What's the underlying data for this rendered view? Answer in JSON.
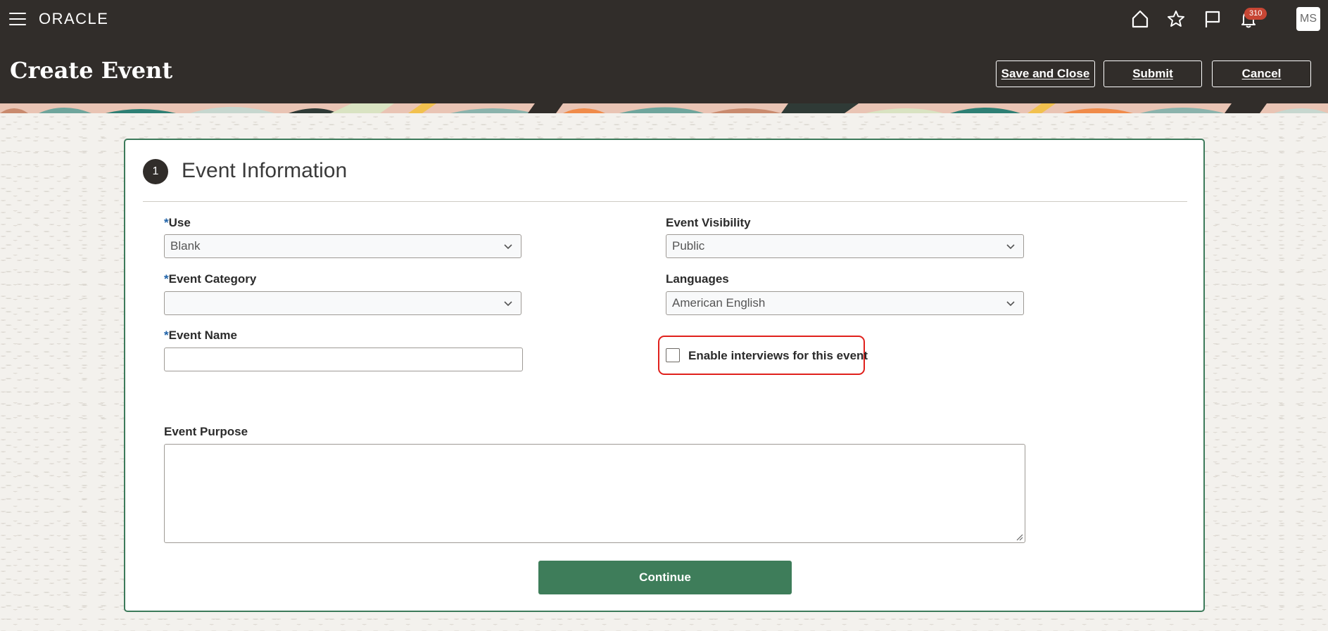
{
  "header": {
    "logo": "ORACLE",
    "notification_count": "310",
    "avatar_initials": "MS",
    "page_title": "Create Event",
    "buttons": {
      "save_and_close": "Save and Close",
      "submit": "Submit",
      "cancel": "Cancel"
    }
  },
  "section": {
    "step_number": "1",
    "title": "Event Information"
  },
  "form": {
    "use": {
      "required": "*",
      "label": "Use",
      "value": "Blank"
    },
    "event_category": {
      "required": "*",
      "label": "Event Category",
      "value": ""
    },
    "event_name": {
      "required": "*",
      "label": "Event Name",
      "value": ""
    },
    "event_visibility": {
      "label": "Event Visibility",
      "value": "Public"
    },
    "languages": {
      "label": "Languages",
      "value": "American English"
    },
    "enable_interviews": {
      "label": "Enable interviews for this event",
      "checked": false
    },
    "event_purpose": {
      "label": "Event Purpose",
      "value": ""
    },
    "continue_label": "Continue"
  },
  "colors": {
    "header_bg": "#312d2a",
    "accent_green": "#3e7d5a",
    "highlight_red": "#e0201c",
    "badge_red": "#c74634",
    "required_blue": "#1e62a8"
  }
}
